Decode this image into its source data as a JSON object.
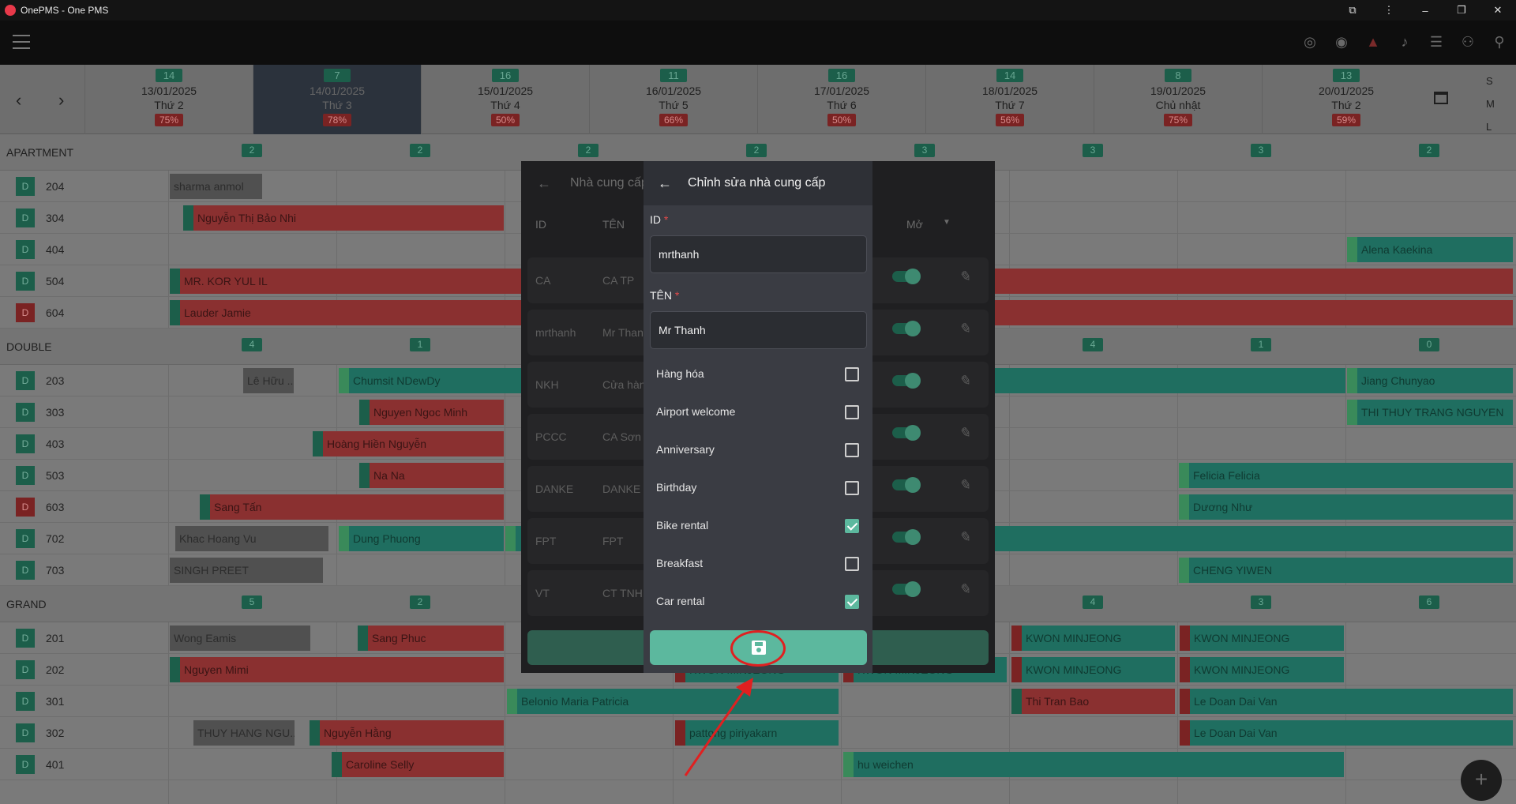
{
  "window": {
    "title": "OnePMS - One PMS"
  },
  "dates": [
    {
      "count": "14",
      "date": "13/01/2025",
      "day": "Thứ 2",
      "pct": "75%"
    },
    {
      "count": "7",
      "date": "14/01/2025",
      "day": "Thứ 3",
      "pct": "78%"
    },
    {
      "count": "16",
      "date": "15/01/2025",
      "day": "Thứ 4",
      "pct": "50%"
    },
    {
      "count": "11",
      "date": "16/01/2025",
      "day": "Thứ 5",
      "pct": "66%"
    },
    {
      "count": "16",
      "date": "17/01/2025",
      "day": "Thứ 6",
      "pct": "50%"
    },
    {
      "count": "14",
      "date": "18/01/2025",
      "day": "Thứ 7",
      "pct": "56%"
    },
    {
      "count": "8",
      "date": "19/01/2025",
      "day": "Chủ nhật",
      "pct": "75%"
    },
    {
      "count": "13",
      "date": "20/01/2025",
      "day": "Thứ 2",
      "pct": "59%"
    }
  ],
  "size_toggle": [
    "S",
    "M",
    "L"
  ],
  "categories": {
    "apartment": {
      "name": "APARTMENT",
      "counts": [
        "2",
        "2",
        "2",
        "2",
        "3",
        "3",
        "3",
        "2"
      ]
    },
    "double": {
      "name": "DOUBLE",
      "counts": [
        "4",
        "1",
        "",
        "",
        "",
        "4",
        "1",
        "0"
      ]
    },
    "grand": {
      "name": "GRAND",
      "counts": [
        "5",
        "2",
        "",
        "",
        "",
        "4",
        "3",
        "6"
      ]
    }
  },
  "rooms": [
    {
      "badge": "D",
      "num": "204"
    },
    {
      "badge": "D",
      "num": "304"
    },
    {
      "badge": "D",
      "num": "404"
    },
    {
      "badge": "D",
      "num": "504"
    },
    {
      "badge": "D",
      "num": "604"
    },
    {
      "badge": "D",
      "num": "203"
    },
    {
      "badge": "D",
      "num": "303"
    },
    {
      "badge": "D",
      "num": "403"
    },
    {
      "badge": "D",
      "num": "503"
    },
    {
      "badge": "D",
      "num": "603"
    },
    {
      "badge": "D",
      "num": "702"
    },
    {
      "badge": "D",
      "num": "703"
    },
    {
      "badge": "D",
      "num": "201"
    },
    {
      "badge": "D",
      "num": "202"
    },
    {
      "badge": "D",
      "num": "301"
    },
    {
      "badge": "D",
      "num": "302"
    },
    {
      "badge": "D",
      "num": "401"
    }
  ],
  "bookings": {
    "b204": "sharma anmol",
    "b304": "Nguyễn Thị Bảo Nhi",
    "b404": "Alena Kaekina",
    "b504": "MR. KOR YUL IL",
    "b604": "Lauder Jamie",
    "b203a": "Lê Hữu ...",
    "b203b": "Chumsit NDewDy",
    "b203c": "Jiang Chunyao",
    "b303a": "Nguyen Ngoc Minh",
    "b303b": "THI THUY TRANG NGUYEN",
    "b403": "Hoàng Hiền Nguyễn",
    "b503a": "Na Na",
    "b503b": "Felicia Felicia",
    "b603a": "Sang Tấn",
    "b603b": "Dương Như",
    "b702a": "Khac Hoang Vu",
    "b702b": "Dung Phuong",
    "b703a": "SINGH PREET",
    "b703b": "CHENG YIWEN",
    "b201a": "Wong Eamis",
    "b201b": "Sang Phuc",
    "b201c": "KWON MINJEONG",
    "b201d": "KWON MINJEONG",
    "b202a": "Nguyen Mimi",
    "b202b": "KWON MINJEONG",
    "b202c": "KWON MINJEONG",
    "b202d": "KWON MINJEONG",
    "b202e": "KWON MINJEONG",
    "b301a": "Belonio Maria Patricia",
    "b301b": "Thi Tran Bao",
    "b301c": "Le Doan Dai Van",
    "b302a": "THUY HANG NGU...",
    "b302b": "Nguyễn Hằng",
    "b302c": "pattong piriyakarn",
    "b302d": "Le Doan Dai Van",
    "b401a": "Caroline Selly",
    "b401b": "hu weichen"
  },
  "supplier_list": {
    "title": "Nhà cung cấp",
    "col_id": "ID",
    "col_name": "TÊN",
    "col_status": "Mở",
    "rows": [
      {
        "id": "CA",
        "name": "CA TP"
      },
      {
        "id": "mrthanh",
        "name": "Mr Thanh"
      },
      {
        "id": "NKH",
        "name": "Cửa hàng"
      },
      {
        "id": "PCCC",
        "name": "CA Sơn T"
      },
      {
        "id": "DANKE",
        "name": "DANKE"
      },
      {
        "id": "FPT",
        "name": "FPT"
      },
      {
        "id": "VT",
        "name": "CT TNHH"
      }
    ]
  },
  "edit_supplier": {
    "title": "Chỉnh sửa nhà cung cấp",
    "id_label": "ID",
    "id_value": "mrthanh",
    "name_label": "TÊN",
    "name_value": "Mr Thanh",
    "required_mark": "*",
    "options": [
      {
        "label": "Hàng hóa",
        "checked": false
      },
      {
        "label": "Airport welcome",
        "checked": false
      },
      {
        "label": "Anniversary",
        "checked": false
      },
      {
        "label": "Birthday",
        "checked": false
      },
      {
        "label": "Bike rental",
        "checked": true
      },
      {
        "label": "Breakfast",
        "checked": false
      },
      {
        "label": "Car rental",
        "checked": true
      }
    ],
    "save_icon": "floppy-disk-icon"
  },
  "colors": {
    "accent": "#5cb89e",
    "annotation": "#e02020"
  }
}
